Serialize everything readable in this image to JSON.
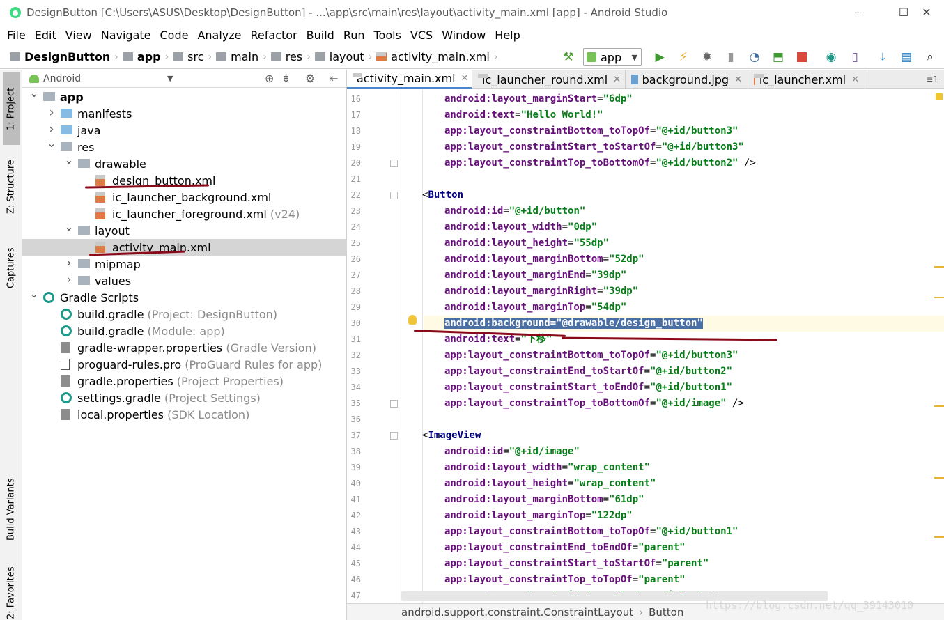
{
  "window": {
    "title": "DesignButton [C:\\Users\\ASUS\\Desktop\\DesignButton] - ...\\app\\src\\main\\res\\layout\\activity_main.xml [app] - Android Studio",
    "controls": [
      "–",
      "☐",
      "✕"
    ]
  },
  "menu": [
    "File",
    "Edit",
    "View",
    "Navigate",
    "Code",
    "Analyze",
    "Refactor",
    "Build",
    "Run",
    "Tools",
    "VCS",
    "Window",
    "Help"
  ],
  "breadcrumb": [
    "DesignButton",
    "app",
    "src",
    "main",
    "res",
    "layout",
    "activity_main.xml"
  ],
  "run_config": "app",
  "left_strip": {
    "project": "1: Project",
    "structure": "Z: Structure",
    "captures": "Captures",
    "build_variants": "Build Variants",
    "favorites": "2: Favorites"
  },
  "project_panel": {
    "view_mode": "Android",
    "tree": [
      {
        "label": "app",
        "hint": "",
        "level": 0,
        "expanded": true,
        "icon": "module-folder-icon",
        "bold": true
      },
      {
        "label": "manifests",
        "hint": "",
        "level": 1,
        "expanded": false,
        "icon": "folder-icon"
      },
      {
        "label": "java",
        "hint": "",
        "level": 1,
        "expanded": false,
        "icon": "folder-icon"
      },
      {
        "label": "res",
        "hint": "",
        "level": 1,
        "expanded": true,
        "icon": "res-folder-icon"
      },
      {
        "label": "drawable",
        "hint": "",
        "level": 2,
        "expanded": true,
        "icon": "folder-icon"
      },
      {
        "label": "design_button.xml",
        "hint": "",
        "level": 3,
        "icon": "xml-file-icon"
      },
      {
        "label": "ic_launcher_background.xml",
        "hint": "",
        "level": 3,
        "icon": "xml-file-icon"
      },
      {
        "label": "ic_launcher_foreground.xml",
        "hint": "(v24)",
        "level": 3,
        "icon": "xml-file-icon"
      },
      {
        "label": "layout",
        "hint": "",
        "level": 2,
        "expanded": true,
        "icon": "folder-icon"
      },
      {
        "label": "activity_main.xml",
        "hint": "",
        "level": 3,
        "icon": "xml-file-icon",
        "selected": true
      },
      {
        "label": "mipmap",
        "hint": "",
        "level": 2,
        "expanded": false,
        "icon": "folder-icon"
      },
      {
        "label": "values",
        "hint": "",
        "level": 2,
        "expanded": false,
        "icon": "folder-icon"
      },
      {
        "label": "Gradle Scripts",
        "hint": "",
        "level": 0,
        "expanded": true,
        "icon": "gradle-icon"
      },
      {
        "label": "build.gradle",
        "hint": "(Project: DesignButton)",
        "level": 1,
        "icon": "gradle-icon"
      },
      {
        "label": "build.gradle",
        "hint": "(Module: app)",
        "level": 1,
        "icon": "gradle-icon"
      },
      {
        "label": "gradle-wrapper.properties",
        "hint": "(Gradle Version)",
        "level": 1,
        "icon": "properties-icon"
      },
      {
        "label": "proguard-rules.pro",
        "hint": "(ProGuard Rules for app)",
        "level": 1,
        "icon": "text-file-icon"
      },
      {
        "label": "gradle.properties",
        "hint": "(Project Properties)",
        "level": 1,
        "icon": "properties-icon"
      },
      {
        "label": "settings.gradle",
        "hint": "(Project Settings)",
        "level": 1,
        "icon": "gradle-icon"
      },
      {
        "label": "local.properties",
        "hint": "(SDK Location)",
        "level": 1,
        "icon": "properties-icon"
      }
    ]
  },
  "tabs": [
    {
      "label": "activity_main.xml",
      "active": true
    },
    {
      "label": "ic_launcher_round.xml",
      "active": false
    },
    {
      "label": "background.jpg",
      "active": false
    },
    {
      "label": "ic_launcher.xml",
      "active": false
    }
  ],
  "tab_overflow": "≡1",
  "code_lines": [
    {
      "n": "16",
      "indent": 2,
      "parts": [
        [
          "attr",
          "android:layout_marginStart"
        ],
        [
          "eq",
          "="
        ],
        [
          "str",
          "\"6dp\""
        ]
      ]
    },
    {
      "n": "17",
      "indent": 2,
      "parts": [
        [
          "attr",
          "android:text"
        ],
        [
          "eq",
          "="
        ],
        [
          "str",
          "\"Hello World!\""
        ]
      ]
    },
    {
      "n": "18",
      "indent": 2,
      "parts": [
        [
          "attr",
          "app:layout_constraintBottom_toTopOf"
        ],
        [
          "eq",
          "="
        ],
        [
          "str",
          "\"@+id/button3\""
        ]
      ]
    },
    {
      "n": "19",
      "indent": 2,
      "parts": [
        [
          "attr",
          "app:layout_constraintStart_toStartOf"
        ],
        [
          "eq",
          "="
        ],
        [
          "str",
          "\"@+id/button3\""
        ]
      ]
    },
    {
      "n": "20",
      "indent": 2,
      "parts": [
        [
          "attr",
          "app:layout_constraintTop_toBottomOf"
        ],
        [
          "eq",
          "="
        ],
        [
          "str",
          "\"@+id/button2\""
        ],
        [
          "lt",
          " />"
        ]
      ]
    },
    {
      "n": "21",
      "indent": 0,
      "parts": []
    },
    {
      "n": "22",
      "indent": 0,
      "parts": [
        [
          "lt",
          "<"
        ],
        [
          "tag",
          "Button"
        ]
      ]
    },
    {
      "n": "23",
      "indent": 2,
      "parts": [
        [
          "attr",
          "android:id"
        ],
        [
          "eq",
          "="
        ],
        [
          "str",
          "\"@+id/button\""
        ]
      ]
    },
    {
      "n": "24",
      "indent": 2,
      "parts": [
        [
          "attr",
          "android:layout_width"
        ],
        [
          "eq",
          "="
        ],
        [
          "str",
          "\"0dp\""
        ]
      ]
    },
    {
      "n": "25",
      "indent": 2,
      "parts": [
        [
          "attr",
          "android:layout_height"
        ],
        [
          "eq",
          "="
        ],
        [
          "str",
          "\"55dp\""
        ]
      ]
    },
    {
      "n": "26",
      "indent": 2,
      "parts": [
        [
          "attr",
          "android:layout_marginBottom"
        ],
        [
          "eq",
          "="
        ],
        [
          "str",
          "\"52dp\""
        ]
      ]
    },
    {
      "n": "27",
      "indent": 2,
      "parts": [
        [
          "attr",
          "android:layout_marginEnd"
        ],
        [
          "eq",
          "="
        ],
        [
          "str",
          "\"39dp\""
        ]
      ]
    },
    {
      "n": "28",
      "indent": 2,
      "parts": [
        [
          "attr",
          "android:layout_marginRight"
        ],
        [
          "eq",
          "="
        ],
        [
          "str",
          "\"39dp\""
        ]
      ]
    },
    {
      "n": "29",
      "indent": 2,
      "parts": [
        [
          "attr",
          "android:layout_marginTop"
        ],
        [
          "eq",
          "="
        ],
        [
          "str",
          "\"54dp\""
        ]
      ]
    },
    {
      "n": "30",
      "indent": 2,
      "selected": true,
      "parts": [
        [
          "attr",
          "android:background"
        ],
        [
          "eq",
          "="
        ],
        [
          "str",
          "\"@drawable/design_button\""
        ]
      ]
    },
    {
      "n": "31",
      "indent": 2,
      "parts": [
        [
          "attr",
          "android:text"
        ],
        [
          "eq",
          "="
        ],
        [
          "str",
          "\"下移\""
        ]
      ]
    },
    {
      "n": "32",
      "indent": 2,
      "parts": [
        [
          "attr",
          "app:layout_constraintBottom_toTopOf"
        ],
        [
          "eq",
          "="
        ],
        [
          "str",
          "\"@+id/button3\""
        ]
      ]
    },
    {
      "n": "33",
      "indent": 2,
      "parts": [
        [
          "attr",
          "app:layout_constraintEnd_toStartOf"
        ],
        [
          "eq",
          "="
        ],
        [
          "str",
          "\"@+id/button2\""
        ]
      ]
    },
    {
      "n": "34",
      "indent": 2,
      "parts": [
        [
          "attr",
          "app:layout_constraintStart_toEndOf"
        ],
        [
          "eq",
          "="
        ],
        [
          "str",
          "\"@+id/button1\""
        ]
      ]
    },
    {
      "n": "35",
      "indent": 2,
      "parts": [
        [
          "attr",
          "app:layout_constraintTop_toBottomOf"
        ],
        [
          "eq",
          "="
        ],
        [
          "str",
          "\"@+id/image\""
        ],
        [
          "lt",
          " />"
        ]
      ]
    },
    {
      "n": "36",
      "indent": 0,
      "parts": []
    },
    {
      "n": "37",
      "indent": 0,
      "parts": [
        [
          "lt",
          "<"
        ],
        [
          "tag",
          "ImageView"
        ]
      ]
    },
    {
      "n": "38",
      "indent": 2,
      "parts": [
        [
          "attr",
          "android:id"
        ],
        [
          "eq",
          "="
        ],
        [
          "str",
          "\"@+id/image\""
        ]
      ]
    },
    {
      "n": "39",
      "indent": 2,
      "parts": [
        [
          "attr",
          "android:layout_width"
        ],
        [
          "eq",
          "="
        ],
        [
          "str",
          "\"wrap_content\""
        ]
      ]
    },
    {
      "n": "40",
      "indent": 2,
      "parts": [
        [
          "attr",
          "android:layout_height"
        ],
        [
          "eq",
          "="
        ],
        [
          "str",
          "\"wrap_content\""
        ]
      ]
    },
    {
      "n": "41",
      "indent": 2,
      "parts": [
        [
          "attr",
          "android:layout_marginBottom"
        ],
        [
          "eq",
          "="
        ],
        [
          "str",
          "\"61dp\""
        ]
      ]
    },
    {
      "n": "42",
      "indent": 2,
      "parts": [
        [
          "attr",
          "android:layout_marginTop"
        ],
        [
          "eq",
          "="
        ],
        [
          "str",
          "\"122dp\""
        ]
      ]
    },
    {
      "n": "43",
      "indent": 2,
      "parts": [
        [
          "attr",
          "app:layout_constraintBottom_toTopOf"
        ],
        [
          "eq",
          "="
        ],
        [
          "str",
          "\"@+id/button1\""
        ]
      ]
    },
    {
      "n": "44",
      "indent": 2,
      "parts": [
        [
          "attr",
          "app:layout_constraintEnd_toEndOf"
        ],
        [
          "eq",
          "="
        ],
        [
          "str",
          "\"parent\""
        ]
      ]
    },
    {
      "n": "45",
      "indent": 2,
      "parts": [
        [
          "attr",
          "app:layout_constraintStart_toStartOf"
        ],
        [
          "eq",
          "="
        ],
        [
          "str",
          "\"parent\""
        ]
      ]
    },
    {
      "n": "46",
      "indent": 2,
      "parts": [
        [
          "attr",
          "app:layout_constraintTop_toTopOf"
        ],
        [
          "eq",
          "="
        ],
        [
          "str",
          "\"parent\""
        ]
      ]
    },
    {
      "n": "47",
      "indent": 2,
      "parts": [
        [
          "attr",
          "app:srcCompat"
        ],
        [
          "eq",
          "="
        ],
        [
          "str",
          "\"@android:drawable/btn_dialog\""
        ],
        [
          "lt",
          " />"
        ]
      ]
    }
  ],
  "status_path": [
    "android.support.constraint.ConstraintLayout",
    "Button"
  ],
  "watermark": "https://blog.csdn.net/qq_39143010",
  "colors": {
    "attr": "#660e7a",
    "string": "#067d17",
    "tag": "#000080",
    "selection": "#4a6fa5",
    "annotation": "#8b0a1a"
  }
}
